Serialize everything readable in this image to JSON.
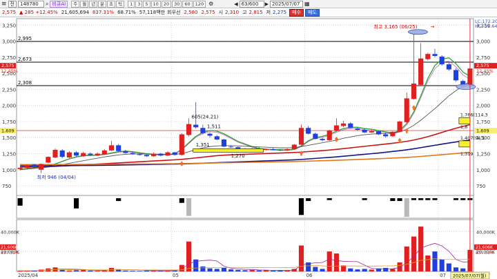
{
  "toolbar": {
    "menu_glyph": "≡",
    "mode": "전",
    "code": "148780",
    "ai_label": "비큐AI",
    "period_buttons": [
      "주",
      "월",
      "년",
      "분",
      "초",
      "틱"
    ],
    "interval_buttons": [
      "1",
      "3",
      "5",
      "10",
      "20",
      "30",
      "60",
      "120"
    ],
    "count": "63/600",
    "date": "2025/07/07"
  },
  "quote": {
    "price": "2,575",
    "change": "▲ 285 +12.45%",
    "volume": "21,605,694",
    "vol_ratio": "837.31%",
    "turnover": "68.71%",
    "amount": "57,118백만",
    "right_label": "회우선",
    "p1": "2,580",
    "p2": "2,575",
    "open_label": "시",
    "open": "2,310",
    "high_label": "고",
    "high": "2,815",
    "low_label": "저",
    "low": "2,275",
    "buy_label": "매수",
    "sell_label": "매도"
  },
  "colors": {
    "up": "#e02020",
    "down": "#1f3fe0",
    "ma5": "#2aa52a",
    "ma20": "#555555",
    "ma60": "#c81414",
    "ma120": "#12128a",
    "ma240": "#e07818",
    "envelope": "#b000b0"
  },
  "price_axis": {
    "ticks": [
      "3,250",
      "3,000",
      "2,750",
      "2,500",
      "2,250",
      "2,000",
      "1,750",
      "1,500",
      "1,250",
      "1,000",
      "750"
    ],
    "tick_values": [
      3250,
      3000,
      2750,
      2500,
      2250,
      2000,
      1750,
      1500,
      1250,
      1000,
      750
    ],
    "current_left": "2,575",
    "current_left_pct": "12.45%",
    "current_right": "2,575",
    "current_right_pct": "12.45%",
    "prev_left": "1,609",
    "prev_right": "1,609",
    "lc": "LC:172.20",
    "hc": "HC:-18.64"
  },
  "hlines": [
    {
      "label": "2,995",
      "value": 2995
    },
    {
      "label": "2,673",
      "value": 2673
    },
    {
      "label": "2,308",
      "value": 2308
    }
  ],
  "prev_close_value": 1609,
  "annotations": {
    "high": "최고 3,165 (06/25)",
    "low": "최저 946 (04/04)",
    "a1": "605(24.21)",
    "a2": "1,511",
    "a3": "1,351",
    "a4": "1,270",
    "a5": "1,766(114.3",
    "a6": "1,407(94.1",
    "a7": "1,319",
    "a8": "1,8"
  },
  "volume_axis": {
    "ticks": [
      "40,000K",
      "20,000K"
    ],
    "tick_values": [
      40000,
      20000
    ],
    "current_left": "21,606K",
    "current_left_pct": "837.31%",
    "current_right": "21,606K",
    "current_right_pct": "837.31%"
  },
  "x_axis": {
    "labels": [
      "2025/04",
      "05",
      "06",
      "07",
      "07/07"
    ],
    "cursor_date": "2025/07/07(월)"
  },
  "chart_data": {
    "type": "candlestick",
    "x": [
      "04/01",
      "04/02",
      "04/03",
      "04/04",
      "04/07",
      "04/08",
      "04/09",
      "04/10",
      "04/11",
      "04/14",
      "04/15",
      "04/16",
      "04/17",
      "04/18",
      "04/21",
      "04/22",
      "04/23",
      "04/24",
      "04/25",
      "04/28",
      "04/29",
      "04/30",
      "05/02",
      "05/07",
      "05/08",
      "05/09",
      "05/12",
      "05/13",
      "05/14",
      "05/15",
      "05/16",
      "05/19",
      "05/20",
      "05/21",
      "05/22",
      "05/23",
      "05/26",
      "05/27",
      "05/28",
      "05/29",
      "05/30",
      "06/02",
      "06/04",
      "06/05",
      "06/09",
      "06/10",
      "06/11",
      "06/12",
      "06/13",
      "06/16",
      "06/17",
      "06/18",
      "06/19",
      "06/20",
      "06/23",
      "06/24",
      "06/25",
      "06/26",
      "06/27",
      "06/30",
      "07/01",
      "07/02",
      "07/03",
      "07/04",
      "07/07"
    ],
    "open": [
      1010,
      1030,
      1080,
      1000,
      1110,
      1190,
      1300,
      1190,
      1270,
      1210,
      1250,
      1220,
      1240,
      1300,
      1380,
      1290,
      1260,
      1240,
      1230,
      1210,
      1250,
      1220,
      1270,
      1230,
      1540,
      1700,
      1650,
      1560,
      1520,
      1470,
      1360,
      1350,
      1320,
      1300,
      1330,
      1310,
      1320,
      1310,
      1300,
      1320,
      1390,
      1650,
      1560,
      1480,
      1460,
      1610,
      1680,
      1720,
      1640,
      1620,
      1580,
      1600,
      1550,
      1520,
      1590,
      1740,
      2100,
      2320,
      2720,
      2800,
      2760,
      2640,
      2550,
      2380,
      2310
    ],
    "close": [
      1030,
      1060,
      1040,
      1090,
      1200,
      1310,
      1200,
      1270,
      1220,
      1260,
      1230,
      1250,
      1300,
      1380,
      1290,
      1260,
      1240,
      1230,
      1210,
      1250,
      1220,
      1270,
      1230,
      1550,
      1710,
      1660,
      1570,
      1530,
      1470,
      1360,
      1350,
      1320,
      1300,
      1330,
      1310,
      1320,
      1310,
      1300,
      1320,
      1390,
      1650,
      1560,
      1480,
      1460,
      1610,
      1690,
      1720,
      1650,
      1620,
      1580,
      1600,
      1550,
      1520,
      1590,
      1750,
      2110,
      2340,
      2730,
      2800,
      2770,
      2640,
      2560,
      2390,
      2290,
      2575
    ],
    "high": [
      1040,
      1080,
      1090,
      1100,
      1210,
      1330,
      1320,
      1290,
      1290,
      1280,
      1270,
      1270,
      1320,
      1450,
      1400,
      1310,
      1280,
      1260,
      1250,
      1270,
      1260,
      1290,
      1280,
      1570,
      1800,
      2050,
      1700,
      1580,
      1540,
      1480,
      1380,
      1360,
      1340,
      1340,
      1350,
      1330,
      1340,
      1320,
      1330,
      1400,
      1700,
      1680,
      1580,
      1500,
      1620,
      1800,
      1760,
      1740,
      1660,
      1640,
      1620,
      1610,
      1580,
      1600,
      1760,
      2200,
      3165,
      2970,
      2820,
      2880,
      2780,
      2680,
      2580,
      2400,
      2815
    ],
    "low": [
      990,
      1010,
      1020,
      946,
      1100,
      1180,
      1180,
      1180,
      1200,
      1200,
      1210,
      1210,
      1230,
      1290,
      1280,
      1250,
      1230,
      1220,
      1200,
      1200,
      1210,
      1210,
      1220,
      1220,
      1520,
      1640,
      1550,
      1500,
      1460,
      1350,
      1340,
      1310,
      1290,
      1290,
      1300,
      1300,
      1300,
      1290,
      1290,
      1310,
      1380,
      1550,
      1470,
      1440,
      1450,
      1600,
      1660,
      1640,
      1610,
      1570,
      1570,
      1540,
      1500,
      1510,
      1580,
      1730,
      2090,
      2300,
      2700,
      2750,
      2620,
      2540,
      2370,
      2260,
      2275
    ],
    "volume": [
      800,
      600,
      900,
      1800,
      3000,
      4000,
      1500,
      900,
      1200,
      2000,
      800,
      600,
      900,
      3500,
      2200,
      800,
      600,
      500,
      700,
      1200,
      600,
      700,
      900,
      6500,
      30000,
      12000,
      5000,
      3000,
      2500,
      3500,
      2000,
      1500,
      1200,
      1500,
      1000,
      1200,
      800,
      900,
      1000,
      2500,
      26000,
      9000,
      4500,
      2500,
      20000,
      18000,
      6000,
      3000,
      2000,
      2500,
      1800,
      3000,
      3500,
      2500,
      9000,
      25000,
      35000,
      45000,
      16000,
      20000,
      12000,
      8000,
      4000,
      3000,
      21606
    ],
    "series": [
      {
        "name": "",
        "values": [
          1000,
          1020,
          1030,
          1040,
          1060,
          1090,
          1130,
          1170,
          1200,
          1220,
          1225,
          1230,
          1240,
          1260,
          1280,
          1290,
          1280,
          1265,
          1250,
          1240,
          1235,
          1240,
          1245,
          1320,
          1420,
          1520,
          1580,
          1610,
          1600,
          1560,
          1500,
          1440,
          1400,
          1360,
          1330,
          1320,
          1315,
          1310,
          1310,
          1320,
          1370,
          1450,
          1500,
          1520,
          1550,
          1600,
          1640,
          1660,
          1660,
          1640,
          1630,
          1610,
          1590,
          1570,
          1610,
          1720,
          1900,
          2150,
          2420,
          2620,
          2720,
          2740,
          2650,
          2520,
          2450
        ]
      },
      {
        "name": "",
        "values": [
          1000,
          1010,
          1020,
          1030,
          1040,
          1060,
          1080,
          1100,
          1120,
          1140,
          1160,
          1180,
          1200,
          1215,
          1230,
          1240,
          1245,
          1245,
          1243,
          1242,
          1240,
          1240,
          1240,
          1250,
          1280,
          1310,
          1340,
          1360,
          1370,
          1375,
          1375,
          1370,
          1365,
          1360,
          1355,
          1350,
          1345,
          1340,
          1340,
          1345,
          1360,
          1380,
          1400,
          1420,
          1440,
          1460,
          1490,
          1510,
          1530,
          1545,
          1555,
          1560,
          1565,
          1570,
          1590,
          1630,
          1690,
          1770,
          1860,
          1950,
          2050,
          2150,
          2230,
          2300,
          2380
        ]
      },
      {
        "name": "",
        "values": [
          1040,
          1042,
          1044,
          1046,
          1048,
          1052,
          1058,
          1064,
          1070,
          1076,
          1082,
          1088,
          1094,
          1100,
          1106,
          1112,
          1118,
          1124,
          1130,
          1136,
          1142,
          1148,
          1154,
          1162,
          1172,
          1184,
          1196,
          1208,
          1218,
          1226,
          1232,
          1236,
          1240,
          1244,
          1248,
          1252,
          1256,
          1260,
          1264,
          1268,
          1274,
          1282,
          1290,
          1298,
          1306,
          1316,
          1328,
          1340,
          1352,
          1364,
          1376,
          1388,
          1400,
          1412,
          1426,
          1442,
          1462,
          1486,
          1514,
          1546,
          1580,
          1614,
          1646,
          1674,
          1700
        ]
      },
      {
        "name": "",
        "values": [
          1060,
          1060,
          1060,
          1061,
          1061,
          1062,
          1063,
          1064,
          1065,
          1066,
          1067,
          1068,
          1069,
          1070,
          1072,
          1074,
          1076,
          1078,
          1080,
          1082,
          1084,
          1086,
          1088,
          1090,
          1094,
          1098,
          1102,
          1106,
          1110,
          1114,
          1118,
          1122,
          1126,
          1130,
          1134,
          1138,
          1142,
          1146,
          1150,
          1154,
          1160,
          1168,
          1176,
          1184,
          1192,
          1200,
          1210,
          1220,
          1230,
          1240,
          1250,
          1260,
          1272,
          1284,
          1296,
          1310,
          1326,
          1344,
          1362,
          1380,
          1398,
          1416,
          1432,
          1448,
          1460
        ]
      },
      {
        "name": "",
        "values": [
          1080,
          1080,
          1080,
          1080,
          1081,
          1081,
          1082,
          1082,
          1083,
          1083,
          1084,
          1084,
          1085,
          1085,
          1086,
          1087,
          1088,
          1089,
          1090,
          1091,
          1092,
          1093,
          1094,
          1096,
          1098,
          1100,
          1102,
          1104,
          1106,
          1108,
          1110,
          1112,
          1114,
          1116,
          1118,
          1120,
          1122,
          1124,
          1126,
          1128,
          1131,
          1134,
          1137,
          1140,
          1143,
          1147,
          1151,
          1155,
          1159,
          1163,
          1167,
          1171,
          1176,
          1181,
          1186,
          1192,
          1199,
          1207,
          1216,
          1225,
          1234,
          1243,
          1252,
          1261,
          1270
        ]
      }
    ],
    "osc": [
      -40,
      0,
      0,
      0,
      0,
      0,
      0,
      0,
      -55,
      0,
      0,
      0,
      0,
      0,
      -15,
      0,
      0,
      0,
      0,
      0,
      0,
      0,
      0,
      -25,
      -95,
      0,
      0,
      0,
      0,
      0,
      0,
      0,
      0,
      0,
      0,
      0,
      0,
      0,
      0,
      0,
      -90,
      -15,
      0,
      0,
      -10,
      0,
      0,
      0,
      0,
      -10,
      0,
      0,
      0,
      -15,
      -15,
      -100,
      -10,
      -10,
      -10,
      -10,
      0,
      0,
      -10,
      -10,
      -10
    ],
    "osc_gray": [
      24,
      50,
      55
    ],
    "ylim": [
      600,
      3350
    ],
    "vol_ylim": [
      0,
      52000
    ]
  }
}
